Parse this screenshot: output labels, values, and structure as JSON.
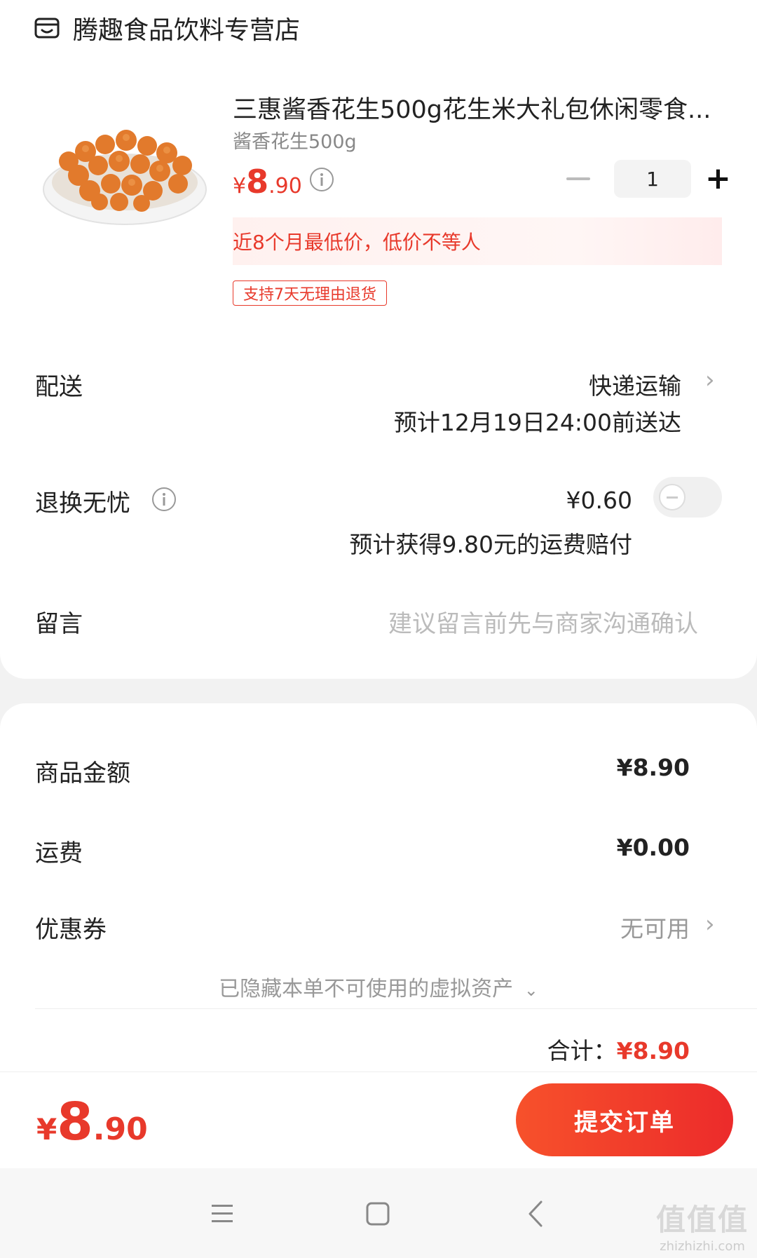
{
  "store": {
    "name": "腾趣食品饮料专营店",
    "icon": "store-icon"
  },
  "product": {
    "title": "三惠酱香花生500g花生米大礼包休闲零食...",
    "spec": "酱香花生500g",
    "price_symbol": "¥",
    "price_int": "8",
    "price_dec": ".90",
    "quantity": "1",
    "low_price_note": "近8个月最低价，低价不等人",
    "return_tag": "支持7天无理由退货"
  },
  "delivery": {
    "label": "配送",
    "method": "快递运输",
    "eta": "预计12月19日24:00前送达"
  },
  "return_insurance": {
    "label": "退换无忧",
    "price": "¥0.60",
    "note": "预计获得9.80元的运费赔付",
    "enabled": false
  },
  "message": {
    "label": "留言",
    "placeholder": "建议留言前先与商家沟通确认"
  },
  "summary": {
    "goods_label": "商品金额",
    "goods_amount": "¥8.90",
    "shipping_label": "运费",
    "shipping_amount": "¥0.00",
    "coupon_label": "优惠券",
    "coupon_value": "无可用",
    "hidden_assets": "已隐藏本单不可使用的虚拟资产",
    "total_label": "合计：",
    "total_amount": "¥8.90"
  },
  "bottom": {
    "price_symbol": "¥",
    "price_int": "8",
    "price_dec": ".90",
    "submit_label": "提交订单"
  },
  "watermark": {
    "big": "值值值",
    "small": "zhizhizhi.com"
  },
  "colors": {
    "accent": "#e8392b",
    "submit_start": "#f7512b",
    "submit_end": "#ec2b2b"
  }
}
